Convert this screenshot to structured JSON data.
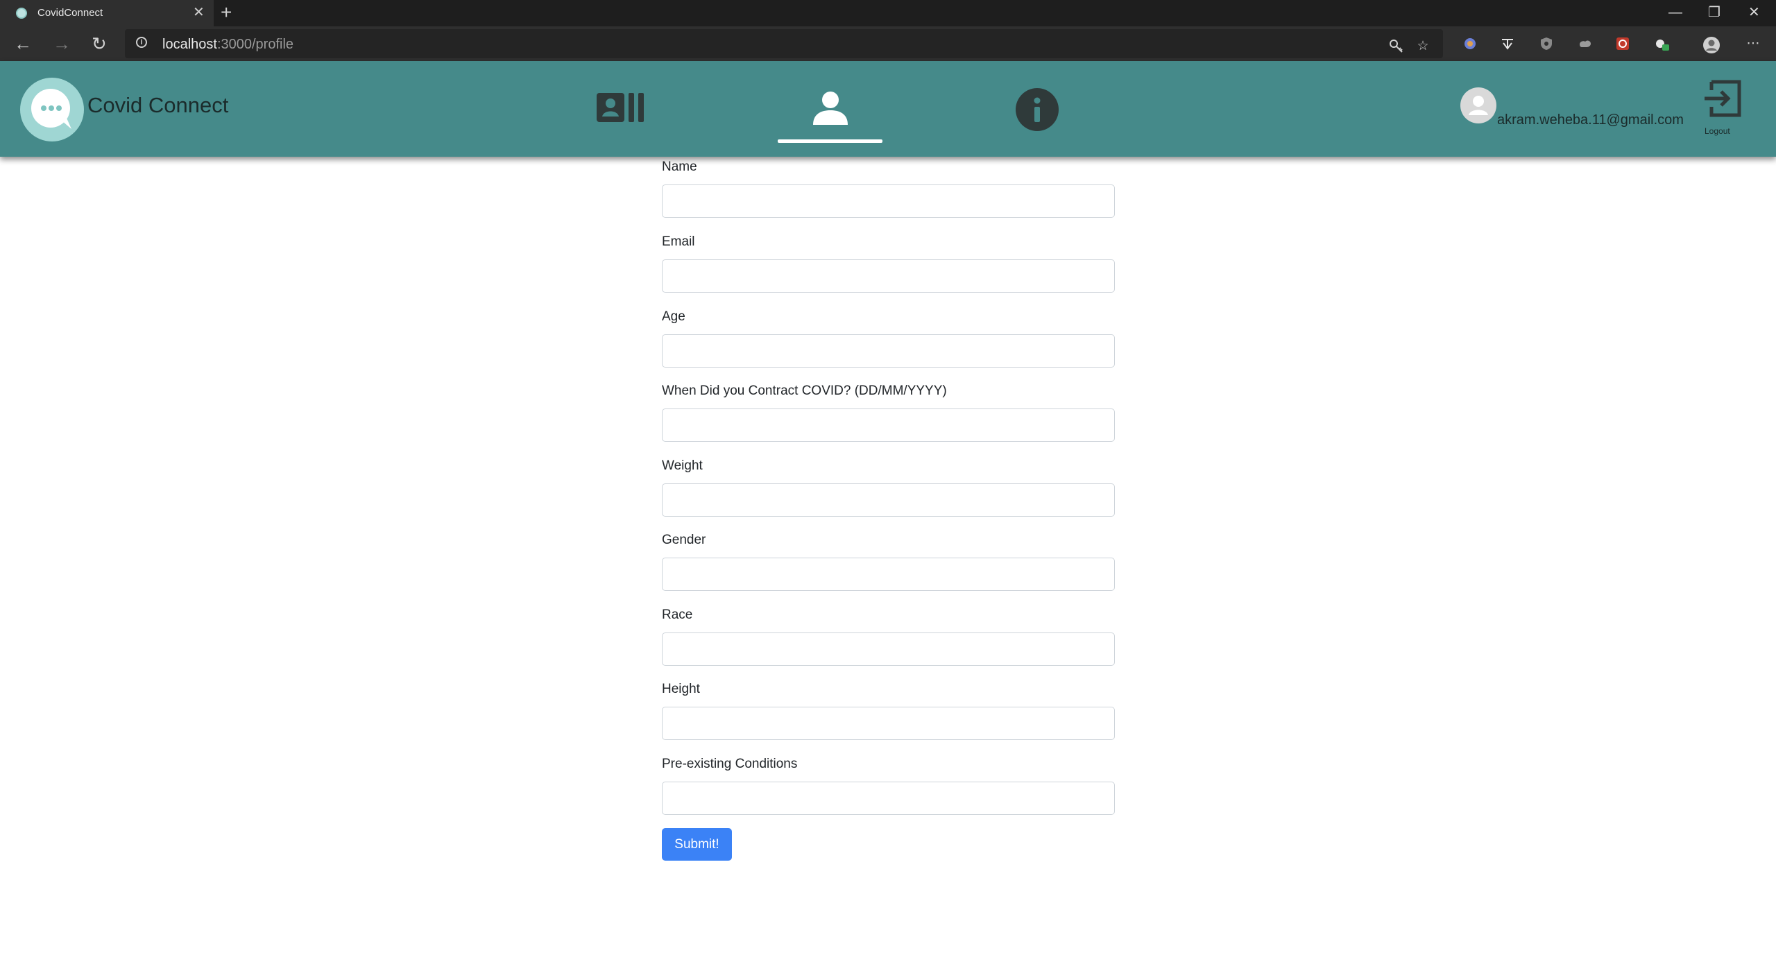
{
  "browser": {
    "tab_title": "CovidConnect",
    "url_host": "localhost",
    "url_rest": ":3000/profile",
    "close_glyph": "✕",
    "new_tab_glyph": "+",
    "minimize_glyph": "—",
    "restore_glyph": "❐",
    "window_close_glyph": "✕",
    "back_glyph": "←",
    "forward_glyph": "→",
    "reload_glyph": "↻",
    "more_glyph": "⋯"
  },
  "header": {
    "brand": "Covid Connect",
    "user_email": "akram.weheba.11@gmail.com",
    "logout_label": "Logout",
    "active_nav": "profile",
    "colors": {
      "header_bg": "#458a8a",
      "icon_dark": "#2f3a3a",
      "logo_bg": "#9fd6d3"
    }
  },
  "form": {
    "fields": [
      {
        "label": "Name",
        "value": ""
      },
      {
        "label": "Email",
        "value": ""
      },
      {
        "label": "Age",
        "value": ""
      },
      {
        "label": "When Did you Contract COVID? (DD/MM/YYYY)",
        "value": ""
      },
      {
        "label": "Weight",
        "value": ""
      },
      {
        "label": "Gender",
        "value": ""
      },
      {
        "label": "Race",
        "value": ""
      },
      {
        "label": "Height",
        "value": ""
      },
      {
        "label": "Pre-existing Conditions",
        "value": ""
      }
    ],
    "submit_label": "Submit!",
    "submit_color": "#3b82f6"
  }
}
